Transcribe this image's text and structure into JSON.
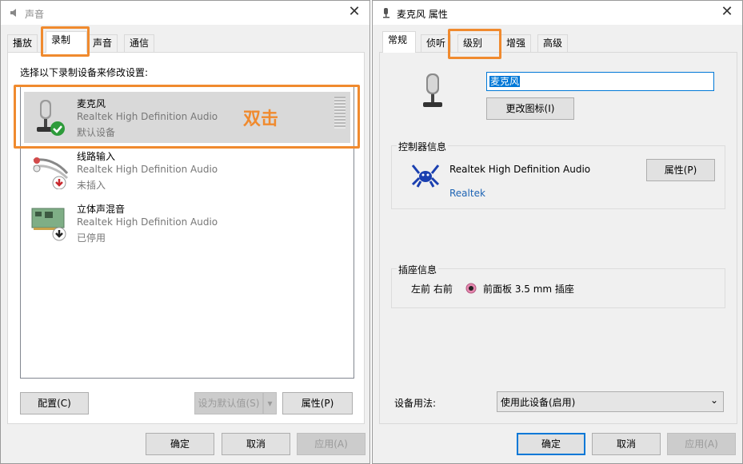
{
  "left": {
    "title": "声音",
    "tabs": [
      "播放",
      "录制",
      "声音",
      "通信"
    ],
    "prompt": "选择以下录制设备来修改设置:",
    "devices": [
      {
        "name": "麦克风",
        "driver": "Realtek High Definition Audio",
        "status": "默认设备"
      },
      {
        "name": "线路输入",
        "driver": "Realtek High Definition Audio",
        "status": "未插入"
      },
      {
        "name": "立体声混音",
        "driver": "Realtek High Definition Audio",
        "status": "已停用"
      }
    ],
    "annotation": "双击",
    "configure_label": "配置(C)",
    "set_default_label": "设为默认值(S)",
    "properties_label": "属性(P)",
    "ok_label": "确定",
    "cancel_label": "取消",
    "apply_label": "应用(A)"
  },
  "right": {
    "title": "麦克风 属性",
    "tabs": [
      "常规",
      "侦听",
      "级别",
      "增强",
      "高级"
    ],
    "device_name_value": "麦克风",
    "change_icon_label": "更改图标(I)",
    "controller_group_label": "控制器信息",
    "controller_name": "Realtek High Definition Audio",
    "controller_vendor": "Realtek",
    "controller_properties_label": "属性(P)",
    "jack_group_label": "插座信息",
    "jack_position": "左前 右前",
    "jack_desc": "前面板 3.5 mm 插座",
    "device_usage_label": "设备用法:",
    "device_usage_value": "使用此设备(启用)",
    "ok_label": "确定",
    "cancel_label": "取消",
    "apply_label": "应用(A)"
  },
  "colors": {
    "highlight": "#f08a2e",
    "link": "#1e64b4",
    "selection": "#d9d9d9"
  }
}
